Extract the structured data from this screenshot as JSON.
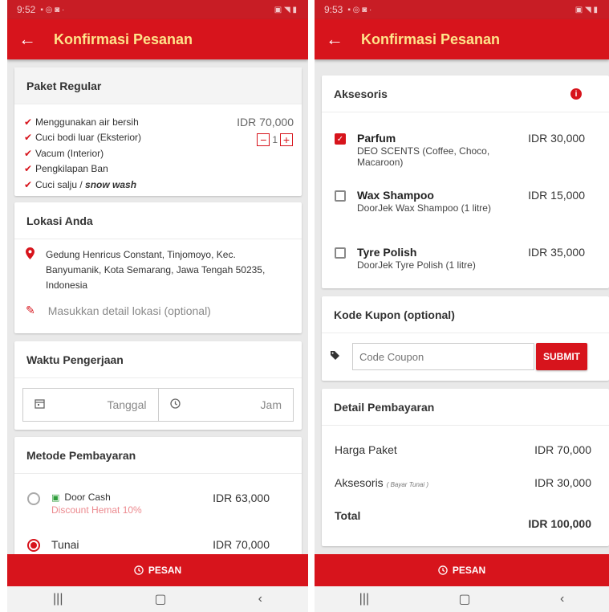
{
  "left": {
    "status": {
      "time": "9:52",
      "icons_left": "▪ ◎ ◙ ·",
      "icons_right": "▣ ◥ ▮"
    },
    "title": "Konfirmasi Pesanan",
    "package": {
      "title": "Paket Regular",
      "features": [
        "Menggunakan air bersih",
        "Cuci bodi luar (Eksterior)",
        "Vacum (Interior)",
        "Pengkilapan Ban"
      ],
      "last_feature_prefix": "Cuci salju / ",
      "last_feature_em": "snow wash",
      "price": "IDR 70,000",
      "quantity": "1"
    },
    "location": {
      "title": "Lokasi Anda",
      "address": "Gedung Henricus Constant, Tinjomoyo, Kec. Banyumanik, Kota Semarang, Jawa Tengah 50235, Indonesia",
      "detail_placeholder": "Masukkan detail lokasi (optional)"
    },
    "schedule": {
      "title": "Waktu Pengerjaan",
      "date_label": "Tanggal",
      "time_label": "Jam"
    },
    "payment": {
      "title": "Metode Pembayaran",
      "options": [
        {
          "name": "Door Cash",
          "note": "Discount Hemat 10%",
          "price": "IDR 63,000",
          "selected": false
        },
        {
          "name": "Tunai",
          "price": "IDR 70,000",
          "selected": true
        }
      ]
    },
    "pesan_label": "PESAN"
  },
  "right": {
    "status": {
      "time": "9:53",
      "icons_left": "▪ ◎ ◙ ·",
      "icons_right": "▣ ◥ ▮"
    },
    "title": "Konfirmasi Pesanan",
    "accessories": {
      "title": "Aksesoris",
      "items": [
        {
          "name": "Parfum",
          "desc": "DEO SCENTS (Coffee, Choco, Macaroon)",
          "price": "IDR 30,000",
          "checked": true
        },
        {
          "name": "Wax Shampoo",
          "desc": "DoorJek Wax Shampoo (1 litre)",
          "price": "IDR 15,000",
          "checked": false
        },
        {
          "name": "Tyre Polish",
          "desc": "DoorJek Tyre Polish (1 litre)",
          "price": "IDR 35,000",
          "checked": false
        }
      ]
    },
    "coupon": {
      "title": "Kode Kupon (optional)",
      "placeholder": "Code Coupon",
      "submit": "SUBMIT"
    },
    "summary": {
      "title": "Detail Pembayaran",
      "package_label": "Harga Paket",
      "package_value": "IDR 70,000",
      "acc_label": "Aksesoris",
      "acc_note": "( Bayar Tunai )",
      "acc_value": "IDR 30,000",
      "total_label": "Total",
      "total_value": "IDR 100,000"
    },
    "pesan_label": "PESAN"
  },
  "colors": {
    "primary": "#d7141c",
    "title_yellow": "#ffe48a",
    "discount": "#ec8a8f"
  },
  "icons": [
    "back-arrow-icon",
    "check-icon",
    "location-pin-icon",
    "pencil-icon",
    "calendar-icon",
    "clock-icon",
    "cash-icon",
    "info-icon",
    "tag-icon"
  ]
}
